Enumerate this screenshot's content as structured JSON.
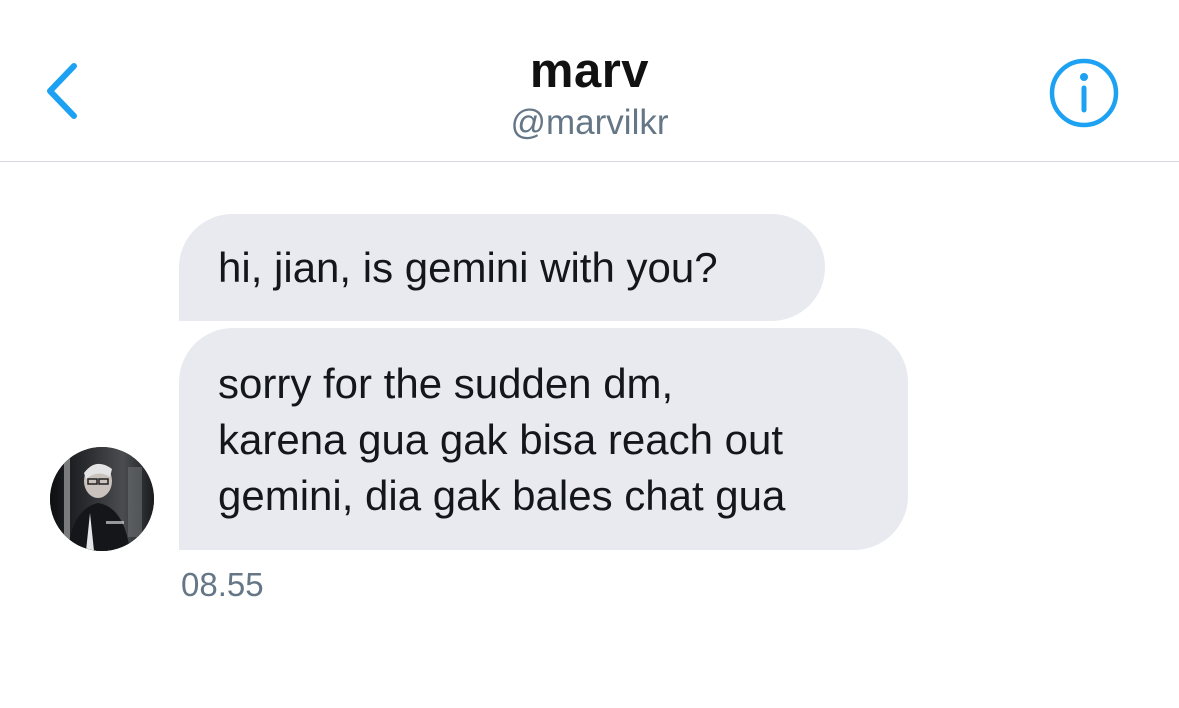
{
  "header": {
    "name": "marv",
    "handle": "@marvilkr",
    "back_icon": "chevron-left-icon",
    "info_icon": "info-circle-icon"
  },
  "conversation": {
    "messages": [
      {
        "lines": [
          "hi, jian, is gemini with you?"
        ]
      },
      {
        "lines": [
          "sorry for the sudden dm,",
          "karena gua gak bisa reach out",
          "gemini, dia gak bales chat gua"
        ]
      }
    ],
    "timestamp": "08.55"
  },
  "colors": {
    "accent": "#1da1f2",
    "bubble": "#e8eaf0",
    "secondary_text": "#657786"
  }
}
